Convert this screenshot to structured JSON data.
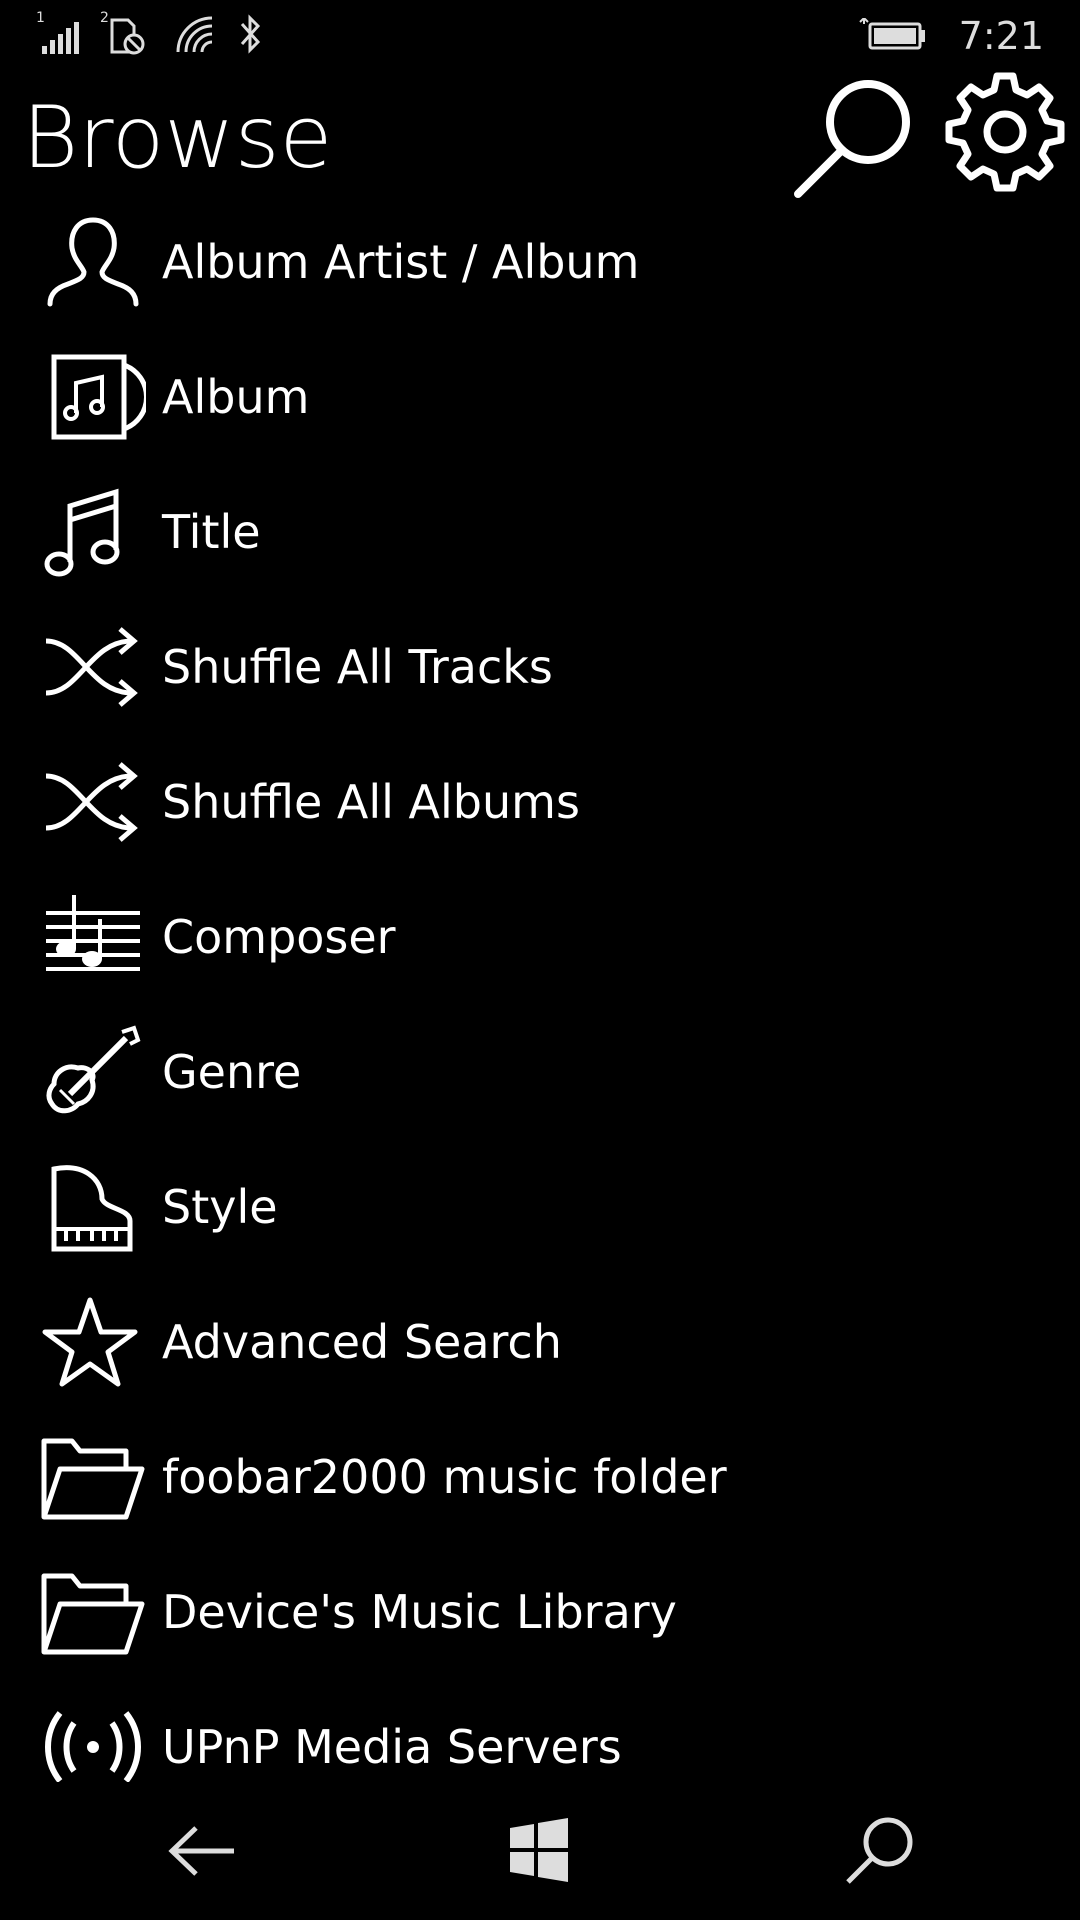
{
  "status_bar": {
    "sim1_label": "1",
    "sim2_label": "2",
    "time": "7:21"
  },
  "header": {
    "title": "Browse"
  },
  "list": {
    "items": [
      {
        "label": "Album Artist / Album",
        "icon": "person-icon"
      },
      {
        "label": "Album",
        "icon": "album-icon"
      },
      {
        "label": "Title",
        "icon": "music-note-icon"
      },
      {
        "label": "Shuffle All Tracks",
        "icon": "shuffle-icon"
      },
      {
        "label": "Shuffle All Albums",
        "icon": "shuffle-icon"
      },
      {
        "label": "Composer",
        "icon": "sheet-music-icon"
      },
      {
        "label": "Genre",
        "icon": "guitar-icon"
      },
      {
        "label": "Style",
        "icon": "piano-icon"
      },
      {
        "label": "Advanced Search",
        "icon": "star-icon"
      },
      {
        "label": "foobar2000 music folder",
        "icon": "folder-icon"
      },
      {
        "label": "Device's Music Library",
        "icon": "folder-icon"
      },
      {
        "label": "UPnP Media Servers",
        "icon": "broadcast-icon"
      }
    ]
  },
  "colors": {
    "background": "#000000",
    "foreground": "#ffffff"
  }
}
